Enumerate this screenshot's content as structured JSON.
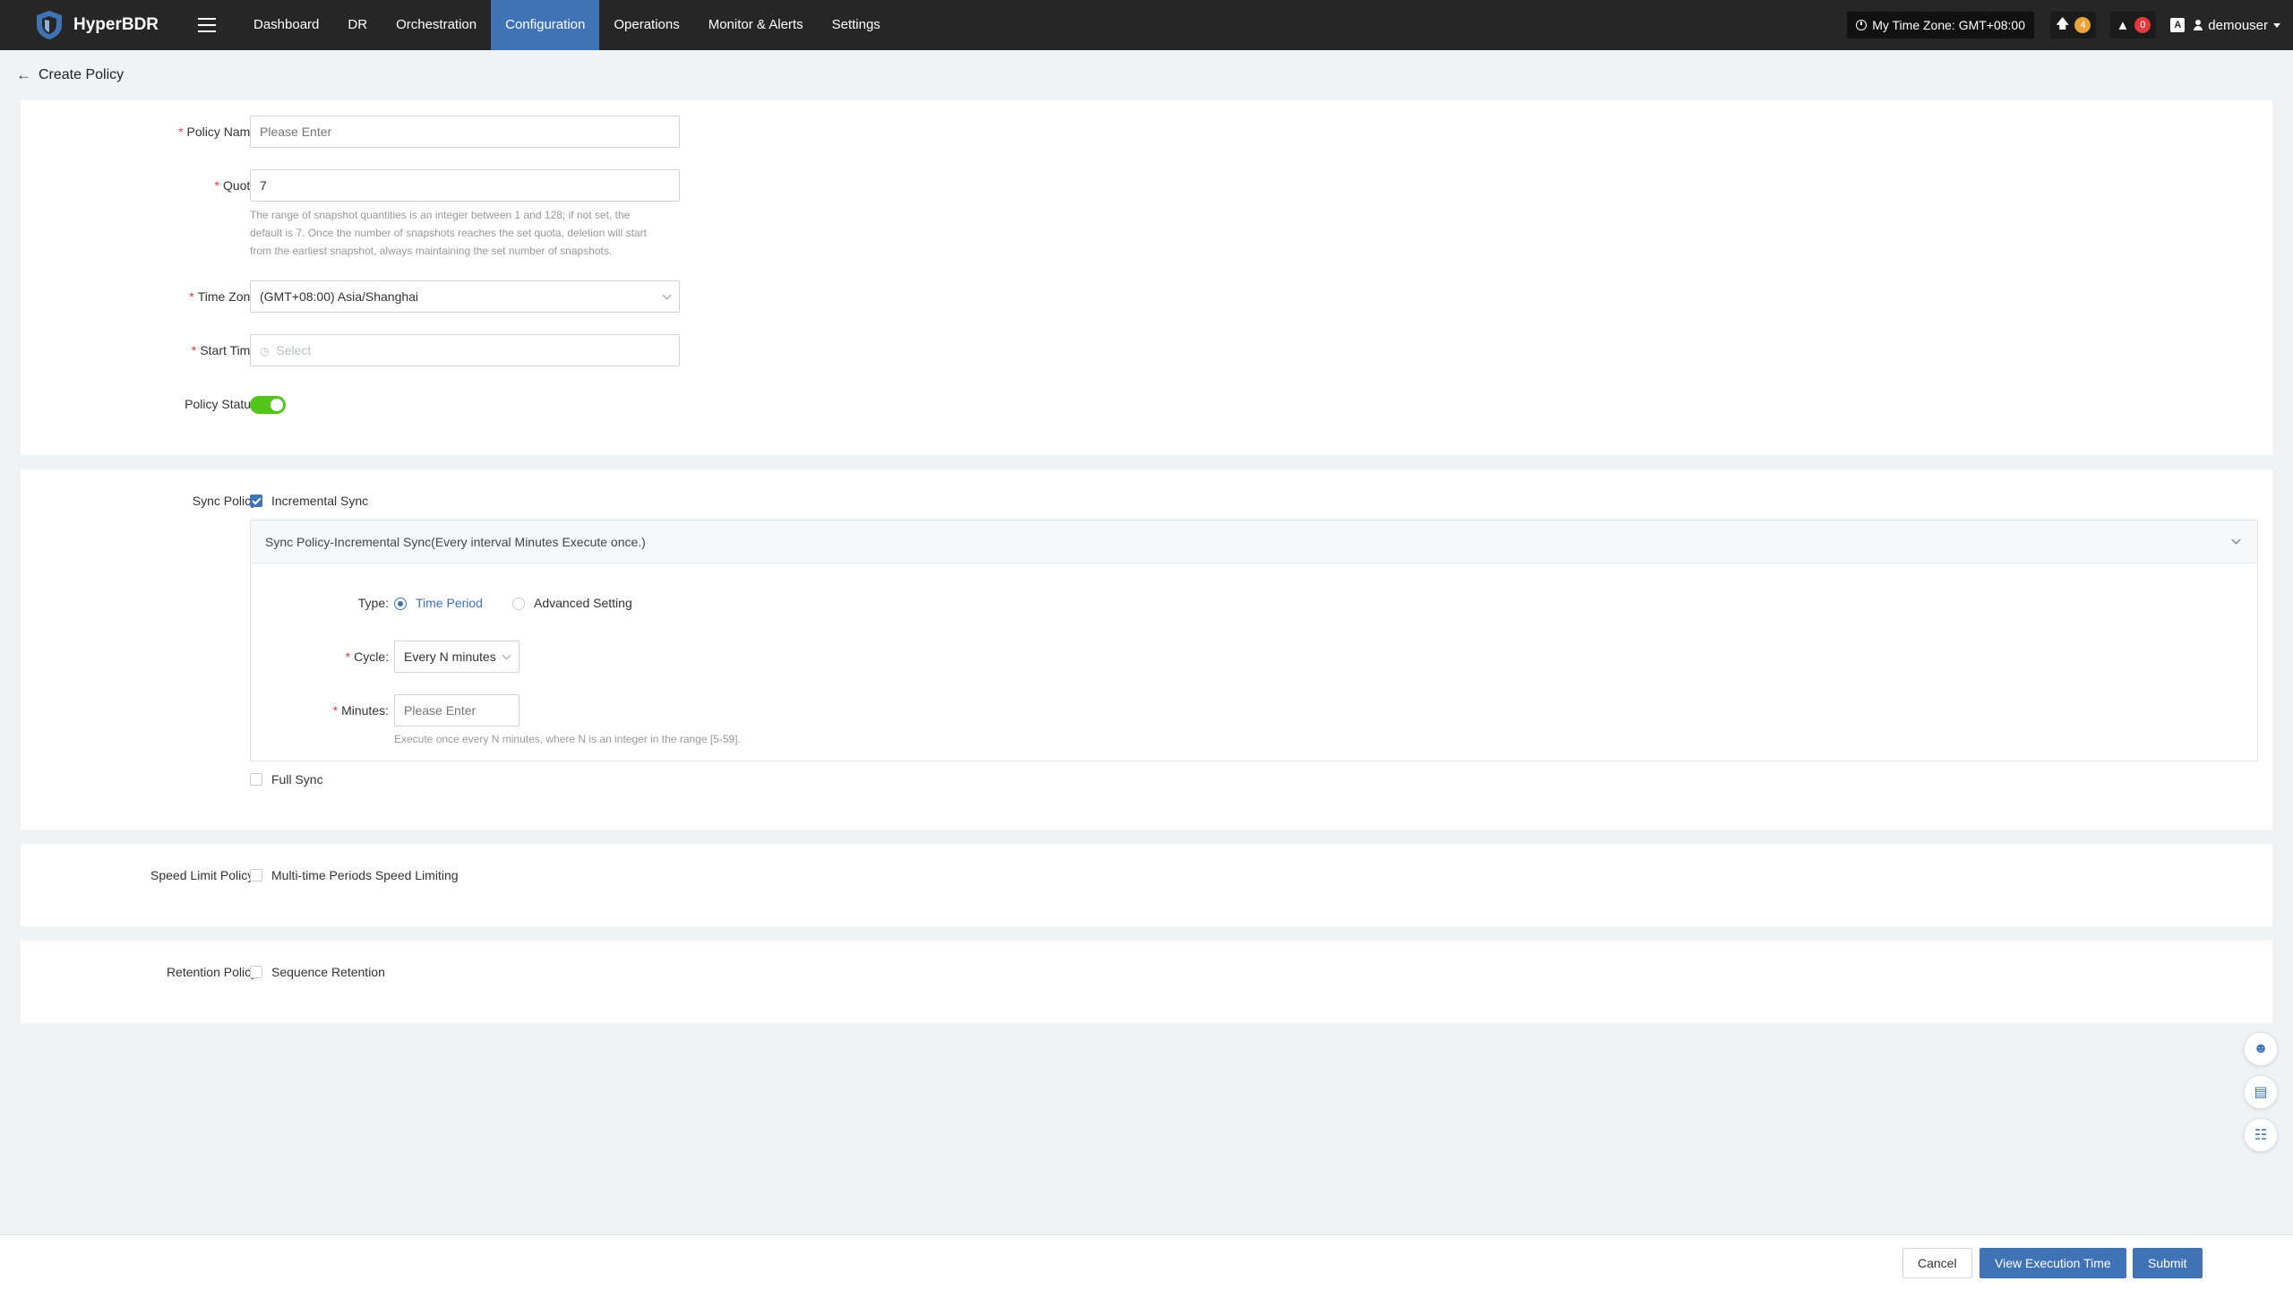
{
  "app": {
    "name": "HyperBDR"
  },
  "nav": {
    "items": [
      {
        "label": "Dashboard"
      },
      {
        "label": "DR"
      },
      {
        "label": "Orchestration"
      },
      {
        "label": "Configuration"
      },
      {
        "label": "Operations"
      },
      {
        "label": "Monitor & Alerts"
      },
      {
        "label": "Settings"
      }
    ],
    "active": "Configuration"
  },
  "topright": {
    "timezone": "My Time Zone: GMT+08:00",
    "upgrade_count": "4",
    "alert_count": "0",
    "font_icon": "A",
    "username": "demouser"
  },
  "page": {
    "title": "Create Policy"
  },
  "form": {
    "policy_name": {
      "label": "Policy Name:",
      "placeholder": "Please Enter"
    },
    "quota": {
      "label": "Quota:",
      "value": "7",
      "hint_line1": "The range of snapshot quantities is an integer between 1 and 128; if not set, the",
      "hint_line2": "default is 7. Once the number of snapshots reaches the set quota, deletion will start",
      "hint_line3": "from the earliest snapshot, always maintaining the set number of snapshots."
    },
    "time_zone": {
      "label": "Time Zone:",
      "value": "(GMT+08:00) Asia/Shanghai"
    },
    "start_time": {
      "label": "Start Time:",
      "placeholder": "Select"
    },
    "policy_status": {
      "label": "Policy Status:",
      "enabled": true
    }
  },
  "sync": {
    "label": "Sync Policy:",
    "incremental": {
      "label": "Incremental Sync",
      "checked": true
    },
    "panel_title": "Sync Policy-Incremental Sync(Every interval Minutes Execute once.)",
    "type_label": "Type:",
    "type_options": [
      {
        "label": "Time Period",
        "selected": true
      },
      {
        "label": "Advanced Setting",
        "selected": false
      }
    ],
    "cycle": {
      "label": "Cycle:",
      "value": "Every N minutes"
    },
    "minutes": {
      "label": "Minutes:",
      "placeholder": "Please Enter",
      "hint": "Execute once every N minutes, where N is an integer in the range [5-59]."
    },
    "full": {
      "label": "Full Sync",
      "checked": false
    }
  },
  "speed_limit": {
    "label": "Speed Limit Policy :",
    "option": "Multi-time Periods Speed Limiting",
    "checked": false
  },
  "retention": {
    "label": "Retention Policy:",
    "option": "Sequence Retention",
    "checked": false
  },
  "footer": {
    "cancel": "Cancel",
    "view_execution": "View Execution Time",
    "submit": "Submit"
  },
  "colors": {
    "topbar": "#262626",
    "accent": "#3f73b6",
    "toggle_on": "#52c41a",
    "required": "#e0393e"
  }
}
